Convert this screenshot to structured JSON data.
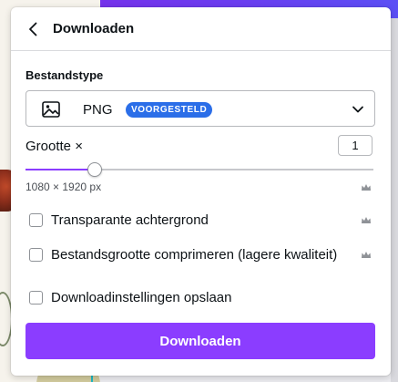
{
  "panel": {
    "title": "Downloaden"
  },
  "file_type": {
    "label": "Bestandstype",
    "value": "PNG",
    "badge": "VOORGESTELD",
    "icon": "image-icon"
  },
  "size": {
    "label": "Grootte ×",
    "value": "1",
    "slider_fraction": 0.2,
    "dimensions": "1080 × 1920 px"
  },
  "options": [
    {
      "label": "Transparante achtergrond",
      "checked": false,
      "premium": true
    },
    {
      "label": "Bestandsgrootte comprimeren (lagere kwaliteit)",
      "checked": false,
      "premium": true
    },
    {
      "label": "Downloadinstellingen opslaan",
      "checked": false,
      "premium": false
    }
  ],
  "actions": {
    "download_label": "Downloaden"
  },
  "colors": {
    "accent": "#8b3dff",
    "badge": "#2b6ee8",
    "crown": "#8f9297"
  }
}
